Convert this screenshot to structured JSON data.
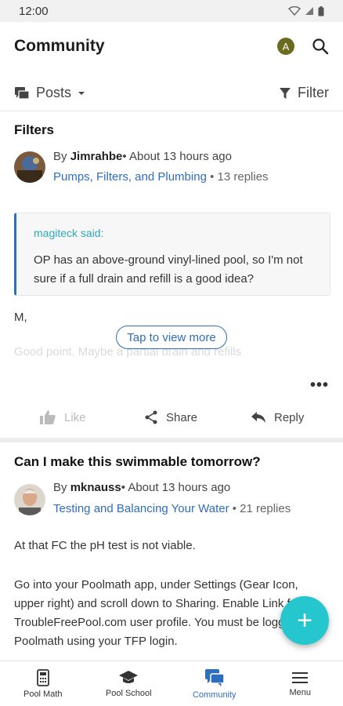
{
  "status_bar": {
    "time": "12:00"
  },
  "app_bar": {
    "title": "Community",
    "avatar_initial": "A"
  },
  "sub_bar": {
    "posts_label": "Posts",
    "filter_label": "Filter"
  },
  "post1": {
    "title": "Filters",
    "by": "By",
    "author": "Jimrahbe",
    "time": "• About 13 hours ago",
    "category": "Pumps, Filters, and Plumbing",
    "replies": "• 13 replies",
    "quote_author": "magiteck said:",
    "quote_text": "OP has an above-ground vinyl-lined pool, so I'm not sure if a full drain and refill is a good idea?",
    "body_line1": "M,",
    "body_faded": "Good point. Maybe a partial drain and refills",
    "tap_more": "Tap to view more",
    "like": "Like",
    "share": "Share",
    "reply": "Reply"
  },
  "post2": {
    "title": "Can I make this swimmable tomorrow?",
    "by": "By",
    "author": "mknauss",
    "time": "• About 13 hours ago",
    "category": "Testing and Balancing Your Water",
    "replies": "• 21 replies",
    "para1": "At that FC the pH test is not viable.",
    "para2": "Go into your Poolmath app, under Settings (Gear Icon, upper right) and scroll down to Sharing. Enable Link from TroubleFreePool.com user profile. You must be logged into Poolmath using your TFP login."
  },
  "fab": {
    "icon": "+"
  },
  "bottom_nav": [
    {
      "label": "Pool Math",
      "icon": "calculator-icon"
    },
    {
      "label": "Pool School",
      "icon": "graduation-cap-icon"
    },
    {
      "label": "Community",
      "icon": "chat-icon"
    },
    {
      "label": "Menu",
      "icon": "menu-icon"
    }
  ],
  "colors": {
    "accent": "#2f6dbd",
    "fab": "#26c6cf",
    "quote_author": "#2fa8b8"
  }
}
